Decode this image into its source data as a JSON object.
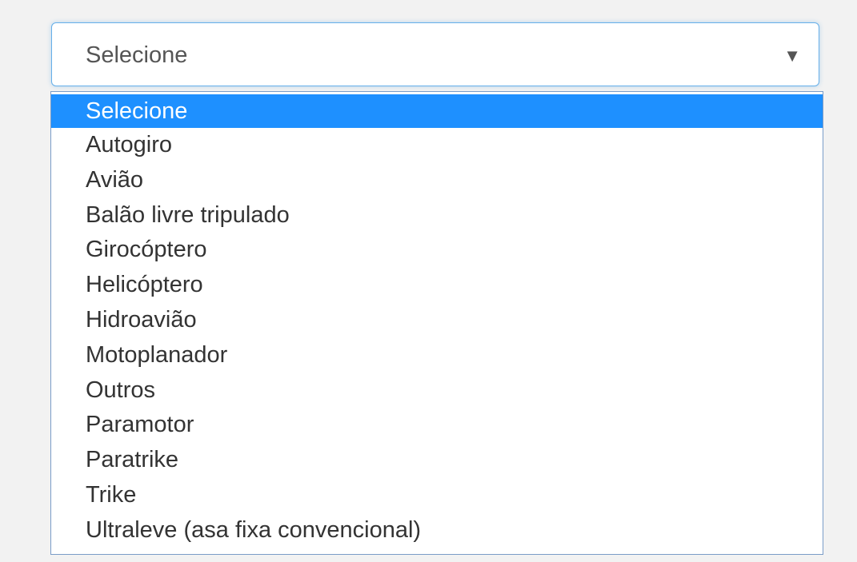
{
  "select": {
    "value": "Selecione",
    "arrow_icon": "▼",
    "focus_color": "#66afe9"
  },
  "dropdown": {
    "highlight_color": "#1e90ff",
    "selected_index": 0,
    "options": [
      "Selecione",
      "Autogiro",
      "Avião",
      "Balão livre tripulado",
      "Girocóptero",
      "Helicóptero",
      "Hidroavião",
      "Motoplanador",
      "Outros",
      "Paramotor",
      "Paratrike",
      "Trike",
      "Ultraleve (asa fixa convencional)"
    ]
  }
}
